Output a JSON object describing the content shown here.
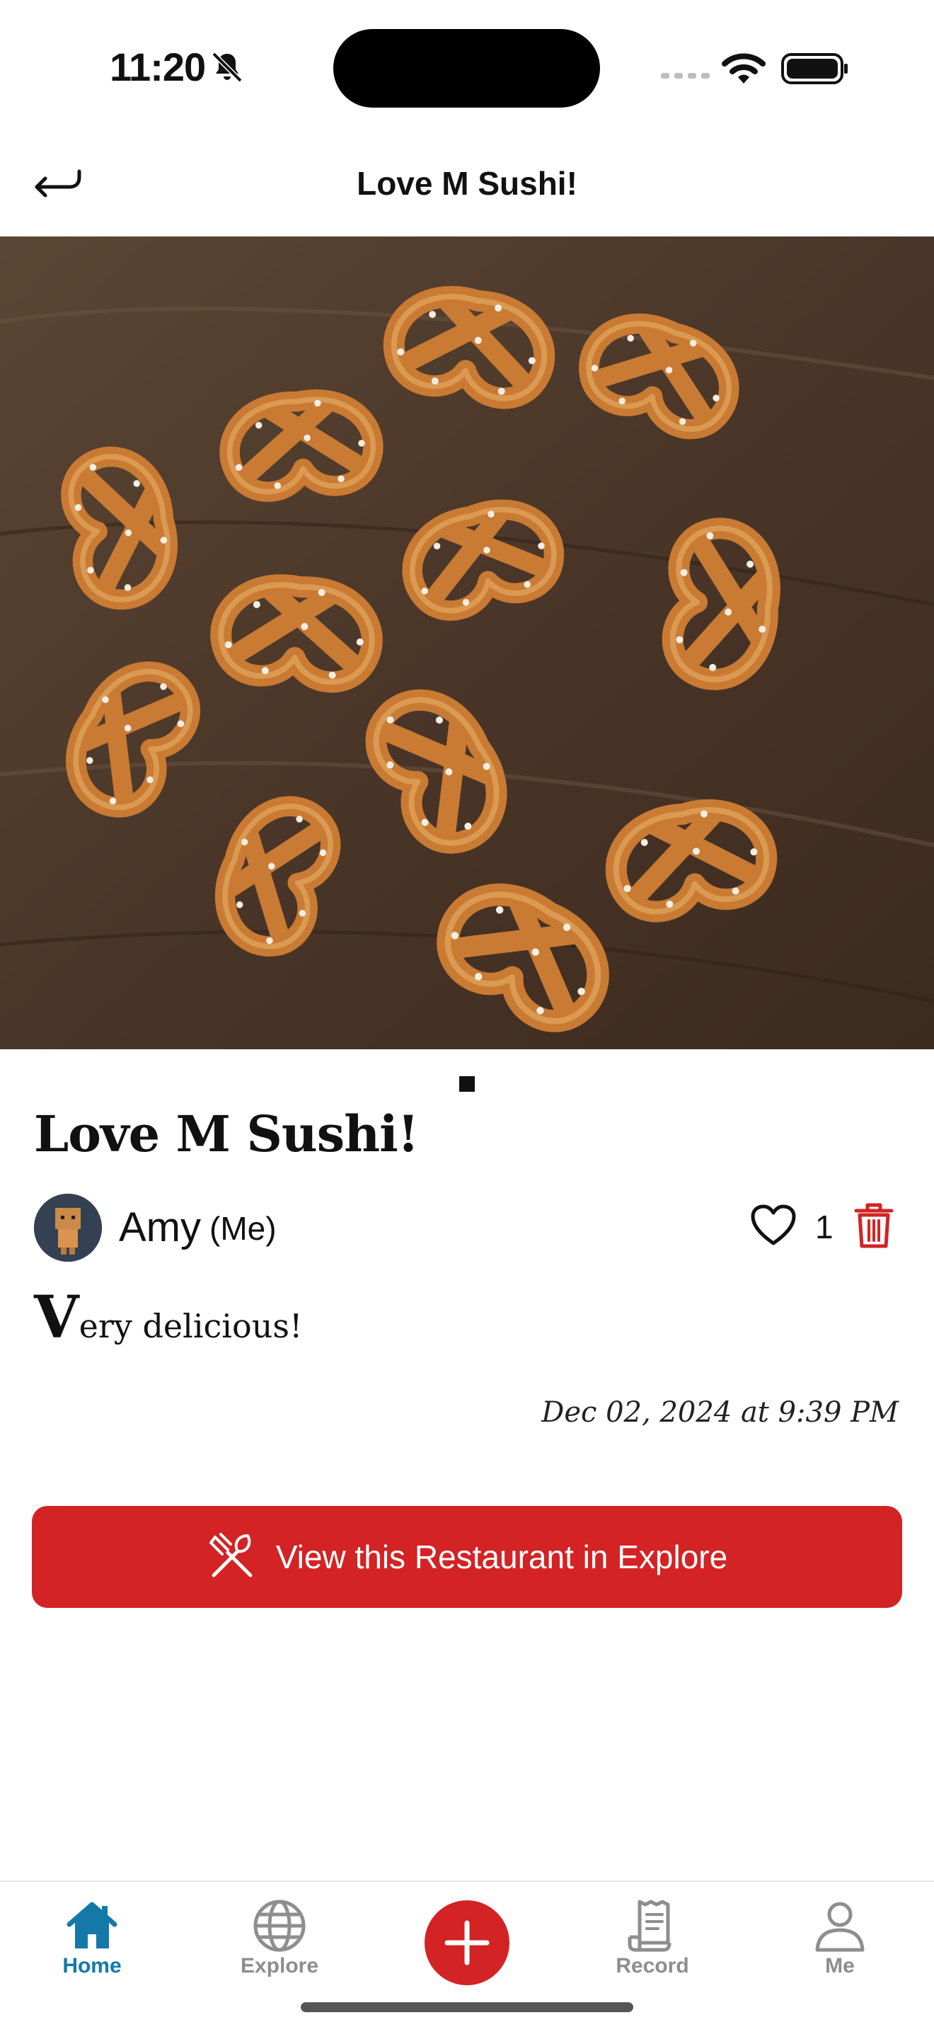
{
  "status_bar": {
    "time": "11:20",
    "icons": [
      "bell-slash-icon",
      "signal-icon",
      "wifi-icon",
      "battery-icon"
    ]
  },
  "nav": {
    "title": "Love M Sushi!",
    "back_icon": "back-arrow-icon"
  },
  "photo": {
    "subject": "pretzels-on-wooden-table",
    "page_indicator_count": 1
  },
  "post": {
    "title": "Love M Sushi!",
    "author": "Amy",
    "author_suffix": "(Me)",
    "likes": "1",
    "body_initial": "V",
    "body_rest": "ery delicious!",
    "date": "Dec 02, 2024 at 9:39 PM"
  },
  "actions": {
    "view_restaurant_label": "View this Restaurant in Explore",
    "view_restaurant_icon": "fork-knife-icon"
  },
  "tabs": [
    {
      "label": "Home",
      "icon": "home-icon",
      "active": true
    },
    {
      "label": "Explore",
      "icon": "globe-icon",
      "active": false
    },
    {
      "label": "",
      "icon": "plus-icon",
      "active": false
    },
    {
      "label": "Record",
      "icon": "receipt-icon",
      "active": false
    },
    {
      "label": "Me",
      "icon": "person-icon",
      "active": false
    }
  ],
  "colors": {
    "accent_red": "#d32324",
    "tab_active": "#1479a8",
    "tab_inactive": "#8e8e8e"
  }
}
